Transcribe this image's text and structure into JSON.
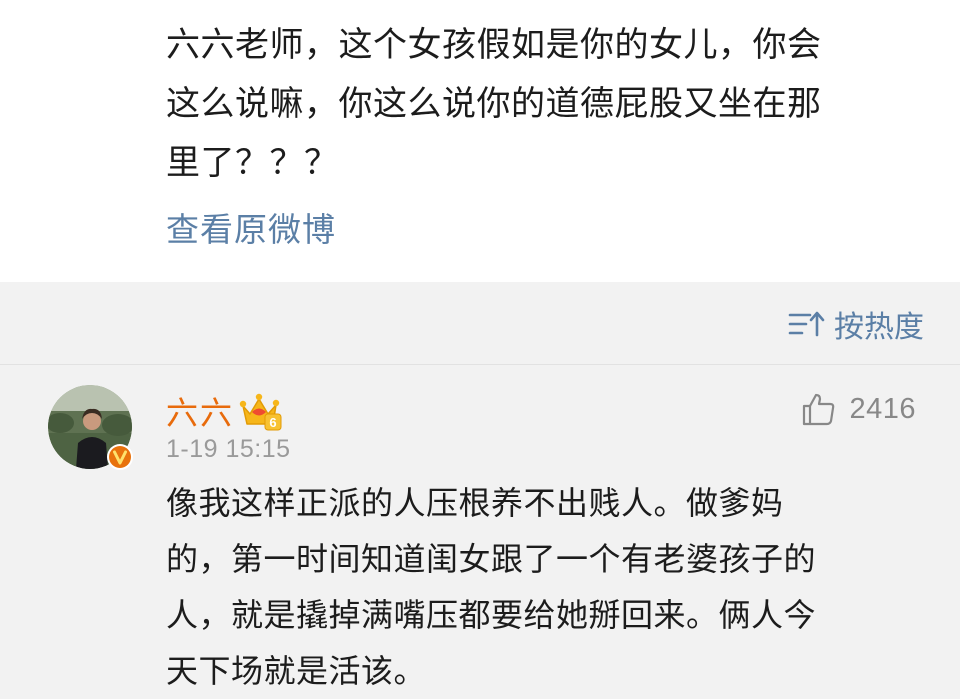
{
  "post": {
    "text": "六六老师，这个女孩假如是你的女儿，你会\n这么说嘛，你这么说你的道德屁股又坐在那\n里了？？？",
    "view_original_label": "查看原微博"
  },
  "comments_header": {
    "sort_label": "按热度",
    "sort_icon": "sort-icon"
  },
  "comment": {
    "username": "六六",
    "vip_badge_icon": "crown-icon",
    "vip_level": "6",
    "verified_icon": "verified-v-icon",
    "timestamp": "1-19 15:15",
    "like_icon": "thumb-up-icon",
    "like_count": "2416",
    "text": "像我这样正派的人压根养不出贱人。做爹妈\n的，第一时间知道闺女跟了一个有老婆孩子的\n人，就是撬掉满嘴压都要给她掰回来。俩人今\n天下场就是活该。"
  },
  "colors": {
    "link_blue": "#5b7fa6",
    "username_orange": "#e86b0c",
    "background_gray": "#f2f2f2",
    "card_white": "#ffffff",
    "meta_gray": "#9a9a9a"
  }
}
